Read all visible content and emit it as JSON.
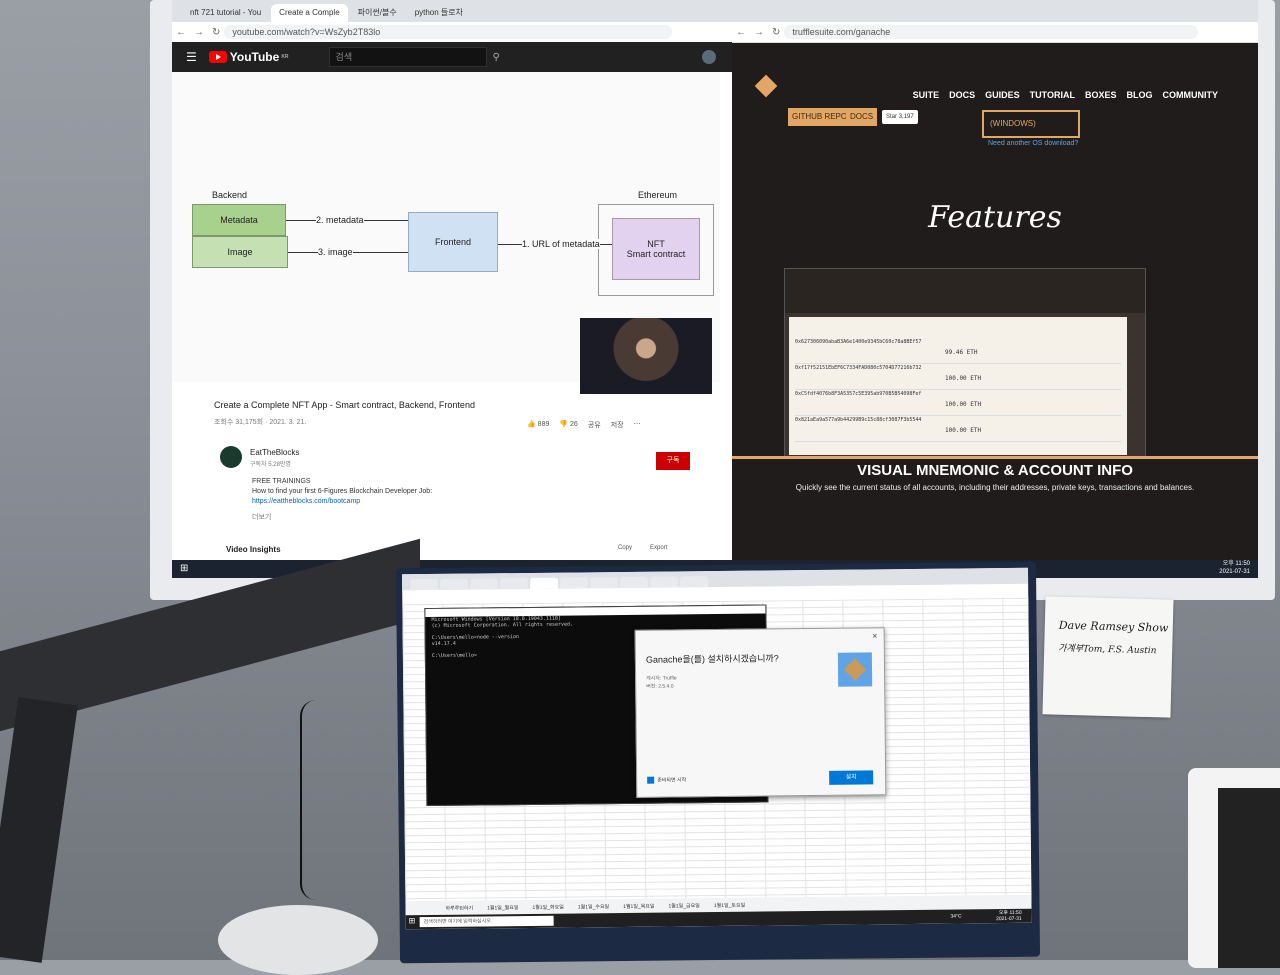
{
  "monitor": {
    "left_browser": {
      "tabs": [
        "nft 721 tutorial - You",
        "Create a Comple",
        "파이썬/블수",
        "python 들로차"
      ],
      "url": "youtube.com/watch?v=WsZyb2T83lo",
      "youtube": {
        "logo": "YouTube",
        "region": "KR",
        "search_placeholder": "검색",
        "diagram": {
          "backend_label": "Backend",
          "ethereum_label": "Ethereum",
          "metadata": "Metadata",
          "image": "Image",
          "frontend": "Frontend",
          "nft_line1": "NFT",
          "nft_line2": "Smart contract",
          "edge_metadata": "2. metadata",
          "edge_image": "3. image",
          "edge_url": "1. URL of metadata"
        },
        "video_title": "Create a Complete NFT App - Smart contract, Backend, Frontend",
        "video_meta": "조회수 31,175회 · 2021. 3. 21.",
        "likes": "889",
        "dislikes": "26",
        "share": "공유",
        "save": "저장",
        "channel": "EatTheBlocks",
        "subscribers": "구독자 5.28만명",
        "subscribe": "구독",
        "desc_line1": "FREE TRAININGS",
        "desc_line2": "How to find your first 6-Figures Blockchain Developer Job:",
        "desc_line3": "https://eattheblocks.com/bootcamp",
        "more": "더보기",
        "insights": "Video Insights",
        "copy": "Copy",
        "export": "Export"
      }
    },
    "right_browser": {
      "url": "trufflesuite.com/ganache",
      "nav": [
        "SUITE",
        "DOCS",
        "GUIDES",
        "TUTORIAL",
        "BOXES",
        "BLOG",
        "COMMUNITY"
      ],
      "github_repo": "GITHUB REPO",
      "docs": "DOCS",
      "star": "Star",
      "star_count": "3,197",
      "download": "(WINDOWS)",
      "another_os": "Need another OS download?",
      "features": "Features",
      "accounts": [
        {
          "address": "0x627306090abaB3A6e1400e9345bC60c78a8BEf57",
          "balance": "99.46 ETH"
        },
        {
          "address": "0xf17f52151EbEF6C7334FAD080c5704D77216b732",
          "balance": "100.00 ETH"
        },
        {
          "address": "0xC5fdf4076b8F3A5357c5E395ab970B5B54098Fef",
          "balance": "100.00 ETH"
        },
        {
          "address": "0x821aEa9a577a9b44299B9c15c88cf3087F3b5544",
          "balance": "100.00 ETH"
        }
      ],
      "vm_title": "VISUAL MNEMONIC & ACCOUNT INFO",
      "vm_desc": "Quickly see the current status of all accounts, including their addresses, private keys, transactions and balances."
    },
    "taskbar": {
      "time": "오후 11:50",
      "date": "2021-07-31"
    }
  },
  "laptop": {
    "cmd": {
      "line1": "Microsoft Windows [Version 10.0.19043.1110]",
      "line2": "(c) Microsoft Corporation. All rights reserved.",
      "line3": "C:\\Users\\mello>node --version",
      "line4": "v14.17.4",
      "line5": "C:\\Users\\mello>"
    },
    "installer": {
      "title": "Ganache을(를) 설치하시겠습니까?",
      "publisher": "게시자: Truffle",
      "version": "버전: 2.5.4.0",
      "check_label": "준비되면 시작",
      "install_button": "설치"
    },
    "sheet_tabs": [
      "하루루틴하기",
      "1월1일_월요일",
      "1월1일_화요일",
      "1월1일_수요일",
      "1월1일_목요일",
      "1월1일_금요일",
      "1월1일_토요일"
    ],
    "search_placeholder": "검색하려면 여기에 입력하십시오.",
    "weather": "34°C",
    "clock": {
      "time": "오후 11:50",
      "date": "2021-07-31"
    }
  },
  "sticky_note": {
    "line1": "Dave Ramsey Show",
    "line2": "가계부Tom, F.S. Austin"
  }
}
